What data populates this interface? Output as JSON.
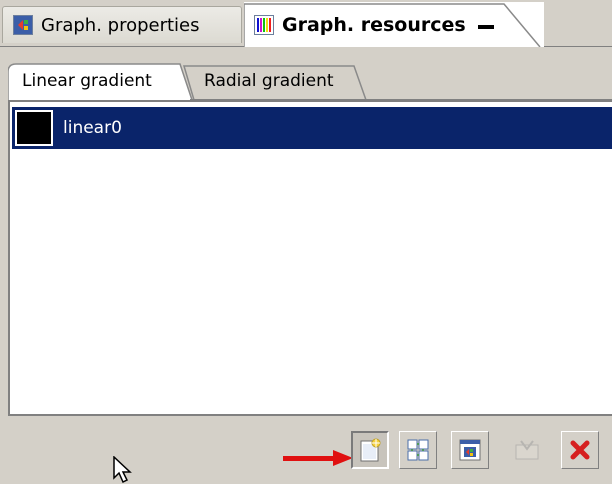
{
  "tabs": {
    "properties_label": "Graph. properties",
    "resources_label": "Graph. resources"
  },
  "inner_tabs": {
    "linear_label": "Linear gradient",
    "radial_label": "Radial gradient"
  },
  "list": {
    "items": [
      {
        "label": "linear0",
        "swatch_color": "#000000",
        "selected": true
      }
    ]
  },
  "toolbar": {
    "buttons": [
      "new-gradient-icon",
      "duplicate-gradient-icon",
      "edit-gradient-icon",
      "apply-gradient-icon",
      "delete-gradient-icon"
    ]
  },
  "colors": {
    "selection": "#0a246a",
    "arrow": "#e01010",
    "delete": "#d62020"
  }
}
